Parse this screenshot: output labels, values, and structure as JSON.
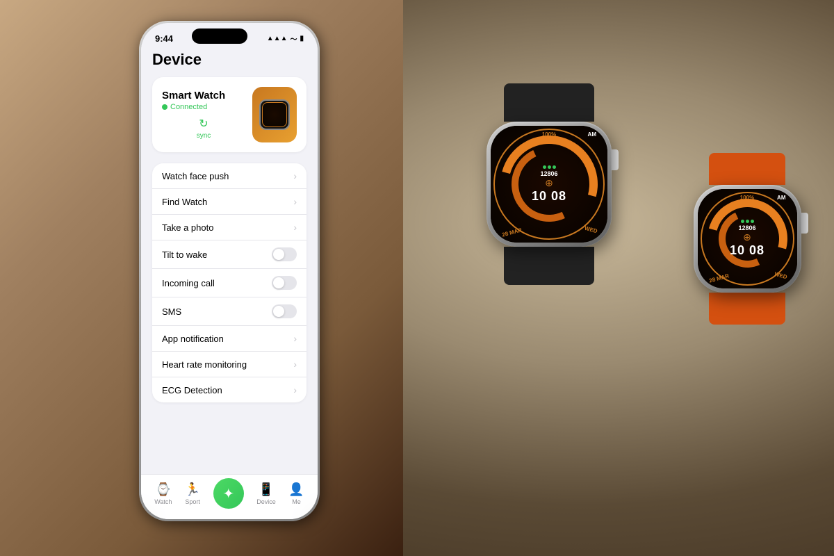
{
  "background": {
    "color": "#7a6a55"
  },
  "phone": {
    "status_bar": {
      "time": "9:44",
      "icons": [
        "signal",
        "wifi",
        "battery"
      ]
    },
    "page_title": "Device",
    "device_card": {
      "name": "Smart Watch",
      "status": "Connected",
      "sync_label": "sync"
    },
    "menu_items": [
      {
        "label": "Watch face push",
        "type": "chevron"
      },
      {
        "label": "Find Watch",
        "type": "chevron"
      },
      {
        "label": "Take a photo",
        "type": "chevron"
      },
      {
        "label": "Tilt to wake",
        "type": "toggle"
      },
      {
        "label": "Incoming call",
        "type": "toggle"
      },
      {
        "label": "SMS",
        "type": "toggle"
      },
      {
        "label": "App notification",
        "type": "chevron"
      },
      {
        "label": "Heart rate monitoring",
        "type": "chevron"
      },
      {
        "label": "ECG Detection",
        "type": "chevron"
      }
    ],
    "bottom_nav": [
      {
        "label": "Watch",
        "icon": "⌚",
        "active": false
      },
      {
        "label": "Sport",
        "icon": "🏃",
        "active": false
      },
      {
        "label": "",
        "icon": "✦",
        "active": true,
        "center": true
      },
      {
        "label": "Device",
        "icon": "📱",
        "active": false
      },
      {
        "label": "Me",
        "icon": "👤",
        "active": false
      }
    ]
  },
  "watch1": {
    "band_color": "black",
    "battery": "100%",
    "time": "10 08",
    "steps": "12806",
    "am_pm": "AM",
    "date_month": "28 MAR",
    "day": "WED"
  },
  "watch2": {
    "band_color": "orange",
    "battery": "100%",
    "time": "10 08",
    "steps": "12806",
    "am_pm": "AM",
    "date_month": "28 MAR",
    "day": "WED"
  }
}
